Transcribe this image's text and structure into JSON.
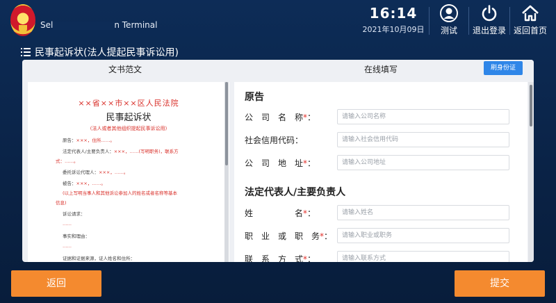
{
  "header": {
    "app_title_start": "Sel",
    "app_title_end": "n Terminal",
    "time": "16:14",
    "date": "2021年10月09日",
    "buttons": [
      {
        "icon": "user-icon",
        "label": "测试"
      },
      {
        "icon": "power-icon",
        "label": "退出登录"
      },
      {
        "icon": "home-icon",
        "label": "返回首页"
      }
    ]
  },
  "page": {
    "title": "民事起诉状(法人提起民事诉讼用)"
  },
  "tabs": {
    "doc_sample": "文书范文",
    "online_fill": "在线填写",
    "id_button": "刷身份证"
  },
  "document": {
    "court_title": "××省××市××区人民法院",
    "title": "民事起诉状",
    "subtitle": "(法人或者其他组织提起民事诉讼用)",
    "lines": [
      {
        "a": "原告：",
        "b": "×××，住所……。",
        "c": ""
      },
      {
        "a": "法定代表人/主要负责人：",
        "b": "×××，……(写明职务)，联系方",
        "c": ""
      },
      {
        "a": "式：",
        "b": "……。",
        "c": ""
      },
      {
        "a": "委托诉讼代理人：",
        "b": "×××，……。",
        "c": ""
      },
      {
        "a": "被告：",
        "b": "×××，……。",
        "c": ""
      },
      {
        "a": "",
        "b": "(以上写明当事人和其他诉讼参加人的姓名或者名称等基本",
        "c": ""
      },
      {
        "a": "",
        "b": "信息)",
        "c": ""
      },
      {
        "a": "诉讼请求：",
        "b": "",
        "c": ""
      },
      {
        "a": "……",
        "b": "",
        "c": ""
      },
      {
        "a": "事实和理由：",
        "b": "",
        "c": ""
      },
      {
        "a": "……",
        "b": "",
        "c": ""
      },
      {
        "a": "证据和证据来源，证人姓名和住所：",
        "b": "",
        "c": ""
      }
    ]
  },
  "form": {
    "plaintiff_section": "原告",
    "rep_section": "法定代表人/主要负责人",
    "fields": [
      {
        "label": "公　司　名　称",
        "required": true,
        "placeholder": "请输入公司名称"
      },
      {
        "label": "社会信用代码：",
        "required": false,
        "placeholder": "请输入社会信用代码"
      },
      {
        "label": "公　司　地　址",
        "required": true,
        "placeholder": "请输入公司地址"
      },
      {
        "label": "姓　　　　　名",
        "required": true,
        "placeholder": "请输入姓名"
      },
      {
        "label": "职　业　或　职　务",
        "required": true,
        "placeholder": "请输入职业或职务"
      },
      {
        "label": "联　系　方　式",
        "required": true,
        "placeholder": "请输入联系方式"
      }
    ],
    "required_mark": "*",
    "colon": "："
  },
  "footer": {
    "back": "返回",
    "submit": "提交"
  },
  "colors": {
    "accent_orange": "#f48a2f",
    "primary_blue": "#2f86e8",
    "bg_navy": "#0d2c57",
    "required_red": "#e2302a"
  }
}
